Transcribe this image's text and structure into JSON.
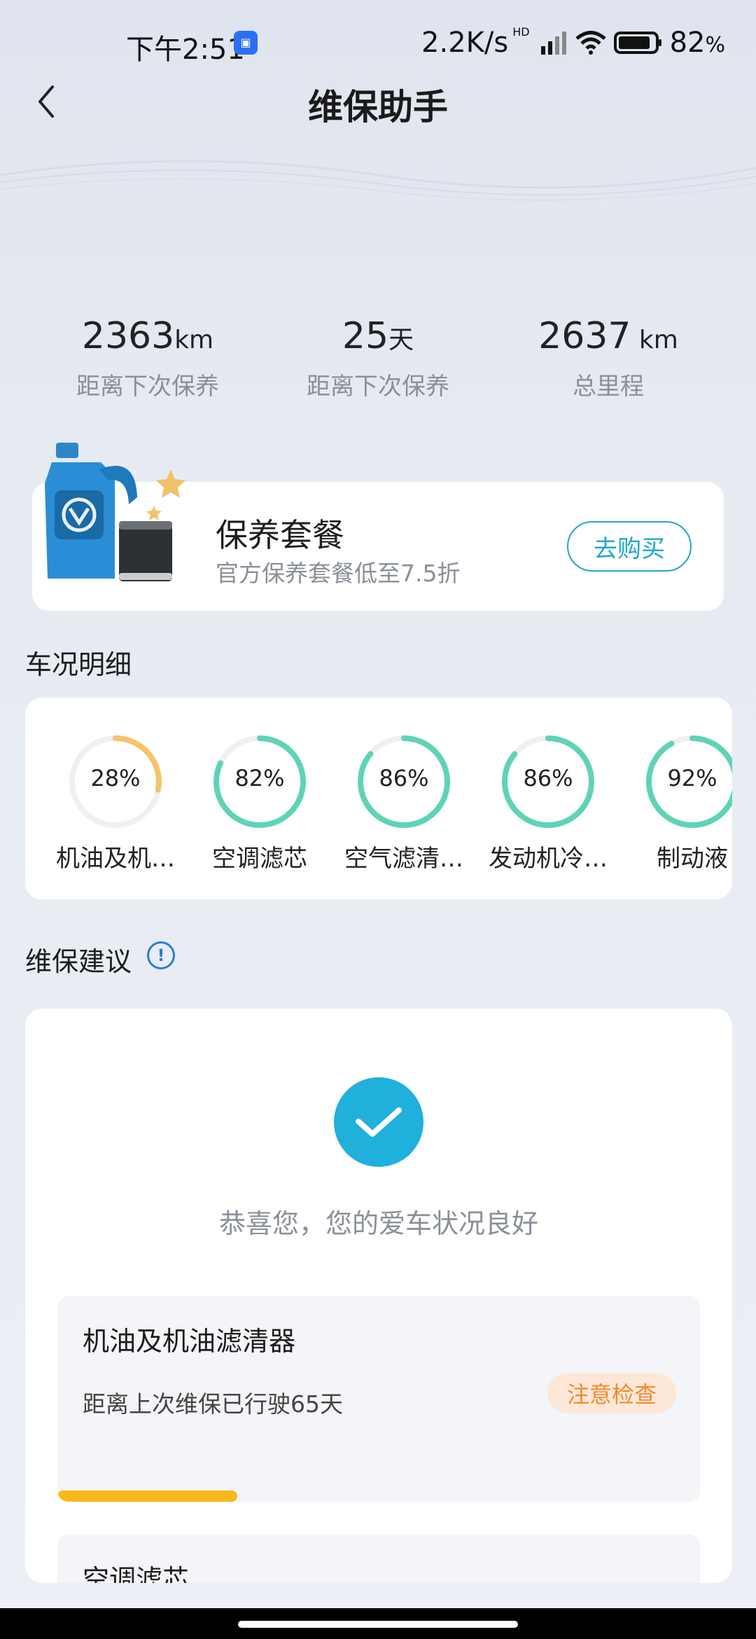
{
  "status": {
    "time": "下午2:51",
    "speed": "2.2K/s",
    "hd": "HD",
    "battery": "82",
    "battery_unit": "%"
  },
  "header": {
    "title": "维保助手",
    "back_icon": "chevron-left-icon"
  },
  "stats": [
    {
      "value": "2363",
      "unit": "km",
      "label": "距离下次保养"
    },
    {
      "value": "25",
      "unit": "天",
      "label": "距离下次保养"
    },
    {
      "value": "2637",
      "unit": " km",
      "label": "总里程"
    }
  ],
  "package": {
    "title": "保养套餐",
    "subtitle": "官方保养套餐低至7.5折",
    "button": "去购买"
  },
  "condition": {
    "title": "车况明细",
    "items": [
      {
        "percent": "28%",
        "value": 28,
        "name": "机油及机…",
        "color": "#f5c36a"
      },
      {
        "percent": "82%",
        "value": 82,
        "name": "空调滤芯",
        "color": "#5fd3b7"
      },
      {
        "percent": "86%",
        "value": 86,
        "name": "空气滤清…",
        "color": "#5fd3b7"
      },
      {
        "percent": "86%",
        "value": 86,
        "name": "发动机冷…",
        "color": "#5fd3b7"
      },
      {
        "percent": "92%",
        "value": 92,
        "name": "制动液",
        "color": "#5fd3b7"
      }
    ]
  },
  "advice": {
    "title": "维保建议",
    "info_icon": "!",
    "ok_text": "恭喜您，您的爱车状况良好",
    "items": [
      {
        "title": "机油及机油滤清器",
        "subtitle": "距离上次维保已行驶65天",
        "badge": "注意检查",
        "progress": 0.28
      },
      {
        "title": "空调滤芯"
      }
    ]
  },
  "colors": {
    "accent": "#1fa8c9",
    "check": "#1fb0dc",
    "warning": "#f08a2e",
    "bar": "#f9b81b"
  }
}
